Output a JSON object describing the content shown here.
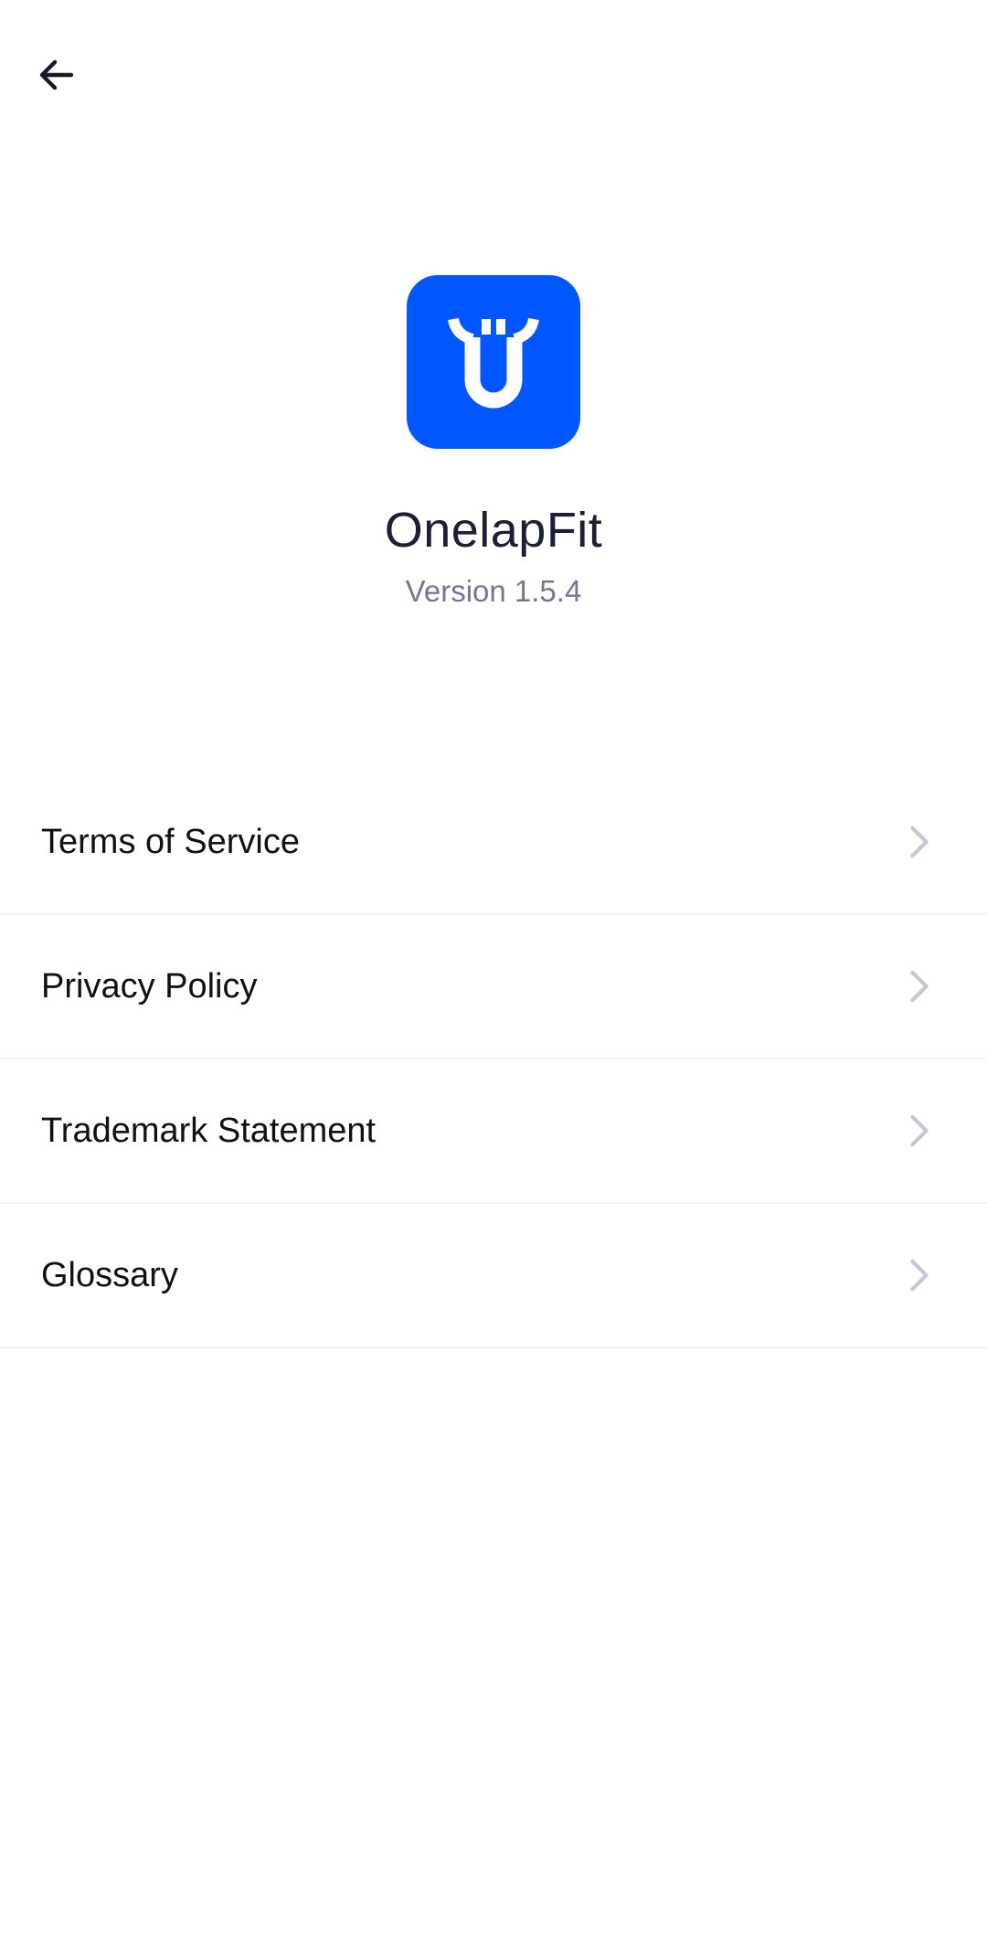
{
  "navigation": {
    "back_icon": "arrow-left-icon"
  },
  "about": {
    "app_name": "OnelapFit",
    "version": "Version 1.5.4",
    "logo_icon": "onelap-logo-icon",
    "brand_color": "#0056ff"
  },
  "menu": {
    "items": [
      {
        "label": "Terms of Service",
        "icon": "chevron-right-icon"
      },
      {
        "label": "Privacy Policy",
        "icon": "chevron-right-icon"
      },
      {
        "label": "Trademark Statement",
        "icon": "chevron-right-icon"
      },
      {
        "label": "Glossary",
        "icon": "chevron-right-icon"
      }
    ],
    "chevron_color": "#c4c7d6"
  }
}
